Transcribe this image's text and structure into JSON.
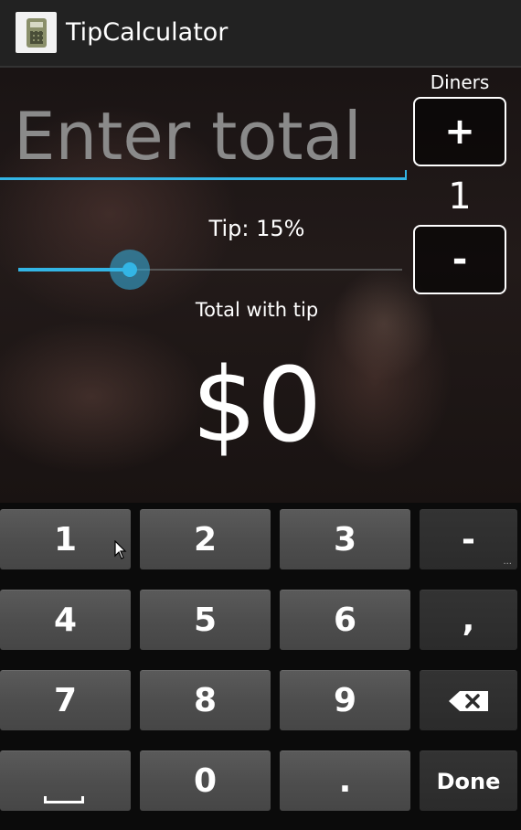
{
  "app": {
    "title": "TipCalculator",
    "icon": "calculator-icon"
  },
  "form": {
    "total_placeholder": "Enter total",
    "total_value": "",
    "tip_label": "Tip: 15%",
    "tip_percent": 15,
    "tip_slider_fraction": 0.29,
    "total_with_tip_label": "Total with tip",
    "total_with_tip_value": "$0"
  },
  "diners": {
    "label": "Diners",
    "plus_label": "+",
    "minus_label": "-",
    "count": "1"
  },
  "keyboard": {
    "keys": [
      "1",
      "2",
      "3",
      "-",
      "4",
      "5",
      "6",
      ",",
      "7",
      "8",
      "9",
      "⌫",
      "",
      "0",
      ".",
      "Done"
    ],
    "more_indicator": "..."
  },
  "colors": {
    "accent": "#33b5e5",
    "action_bar": "#222222",
    "key": "#4d4d4d",
    "key_dark": "#2b2b2b"
  }
}
